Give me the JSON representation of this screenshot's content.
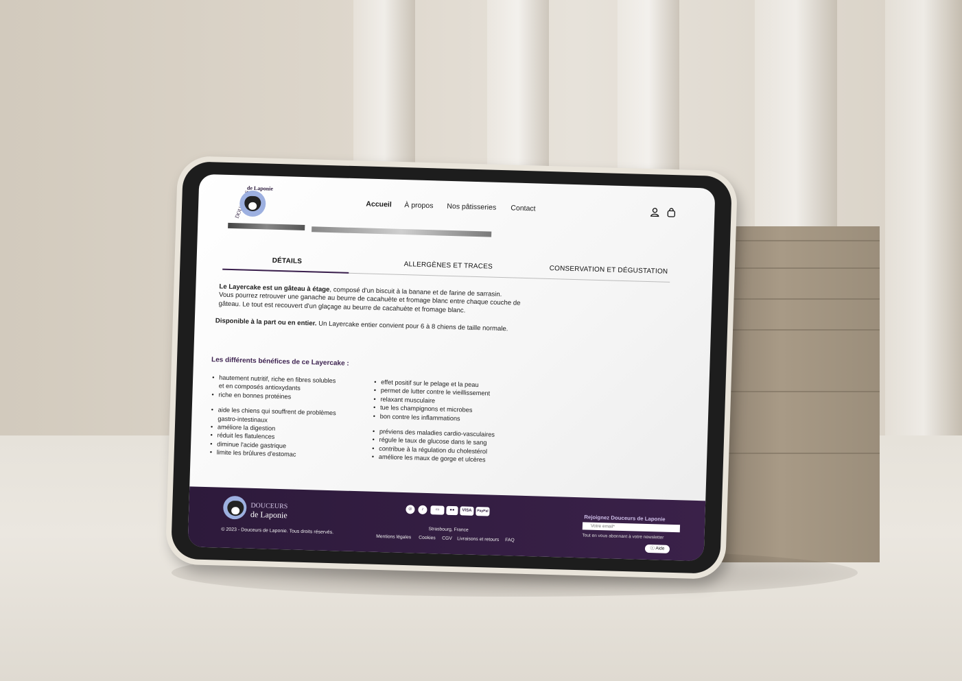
{
  "nav": {
    "items": [
      {
        "label": "Accueil",
        "active": true
      },
      {
        "label": "À propos",
        "active": false
      },
      {
        "label": "Nos pâtisseries",
        "active": false
      },
      {
        "label": "Contact",
        "active": false
      }
    ],
    "icons": [
      "user-icon",
      "bag-icon"
    ]
  },
  "logo": {
    "arc_text": "DOUCEURS",
    "script_text": "de Laponie"
  },
  "tabs": [
    {
      "label": "DÉTAILS",
      "active": true
    },
    {
      "label": "ALLERGÈNES ET TRACES",
      "active": false
    },
    {
      "label": "CONSERVATION ET DÉGUSTATION",
      "active": false
    }
  ],
  "details": {
    "intro_bold": "Le Layercake est un gâteau à étage",
    "intro_rest": ", composé d'un biscuit à la banane et de farine de sarrasin.",
    "line2": "Vous pourrez retrouver une ganache au beurre de cacahuète et fromage blanc entre chaque couche de",
    "line3": "gâteau. Le tout est recouvert d'un glaçage au beurre de cacahuète et fromage blanc.",
    "avail_bold": "Disponible à la part ou en entier.",
    "avail_rest": " Un Layercake entier convient pour 6 à 8 chiens de taille normale."
  },
  "benefits": {
    "title": "Les différents bénéfices de ce Layercake :",
    "col1": [
      "hautement nutritif, riche en fibres solubles",
      "et en composés antioxydants",
      "riche en bonnes protéines",
      "",
      "aide les chiens qui souffrent de problèmes",
      "gastro-intestinaux",
      "améliore la digestion",
      "réduit les flatulences",
      "diminue l'acide gastrique",
      "limite les brûlures d'estomac"
    ],
    "col2": [
      "effet positif sur le pelage et la peau",
      "permet de lutter contre le vieillissement",
      "relaxant musculaire",
      "tue les champignons et microbes",
      "bon contre les inflammations",
      "",
      "préviens des maladies cardio-vasculaires",
      "régule le taux de glucose dans le sang",
      "contribue à la régulation du cholestérol",
      "améliore les maux de gorge et ulcères"
    ]
  },
  "footer": {
    "brand_line1": "DOUCEURS",
    "brand_line2": "de Laponie",
    "copyright": "© 2023 - Douceurs de Laponie. Tous droits réservés.",
    "payments": [
      "instagram-icon",
      "tiktok-icon",
      "amex-icon",
      "mastercard-icon",
      "VISA",
      "PayPal"
    ],
    "city": "Strasbourg, France",
    "links": [
      "Mentions légales",
      "Cookies",
      "CGV",
      "Livraisons et retours",
      "FAQ"
    ],
    "newsletter_title": "Rejoignez Douceurs de Laponie",
    "email_placeholder": "Votre email*",
    "newsletter_note": "Tout en vous abonnant à votre newsletter",
    "help_label": "Aide"
  },
  "colors": {
    "brand_purple": "#3a1f4d",
    "footer_bg": "#2d1a3b",
    "logo_blue": "#9db0e0"
  }
}
